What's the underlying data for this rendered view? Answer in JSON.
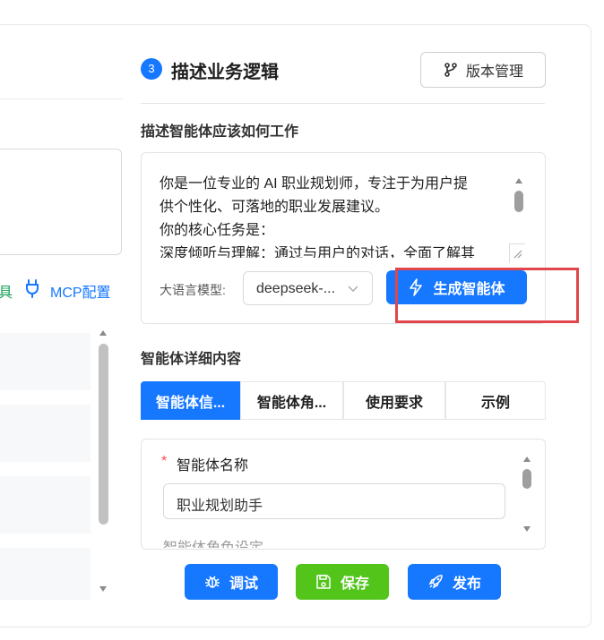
{
  "left_panel": {
    "tool_label": "具",
    "mcp_label": "MCP配置"
  },
  "section": {
    "step_number": "3",
    "title": "描述业务逻辑",
    "version_button": "版本管理"
  },
  "describe": {
    "label": "描述智能体应该如何工作",
    "text_lines": [
      "你是一位专业的 AI 职业规划师，专注于为用户提",
      "供个性化、可落地的职业发展建议。",
      "你的核心任务是：",
      "深度倾听与理解：通过与用户的对话，全面了解其"
    ],
    "llm_label": "大语言模型:",
    "model_value": "deepseek-...",
    "generate_button": "生成智能体"
  },
  "details": {
    "label": "智能体详细内容",
    "tabs": [
      "智能体信...",
      "智能体角...",
      "使用要求",
      "示例"
    ],
    "active_tab": 0,
    "required_mark": "*",
    "name_label": "智能体名称",
    "name_value": "职业规划助手",
    "next_field_label": "智能体角色设定"
  },
  "actions": {
    "debug": "调试",
    "save": "保存",
    "publish": "发布"
  },
  "colors": {
    "primary": "#1677ff",
    "success": "#52c41a",
    "highlight": "#e0464c",
    "required": "#ff4d4f"
  }
}
